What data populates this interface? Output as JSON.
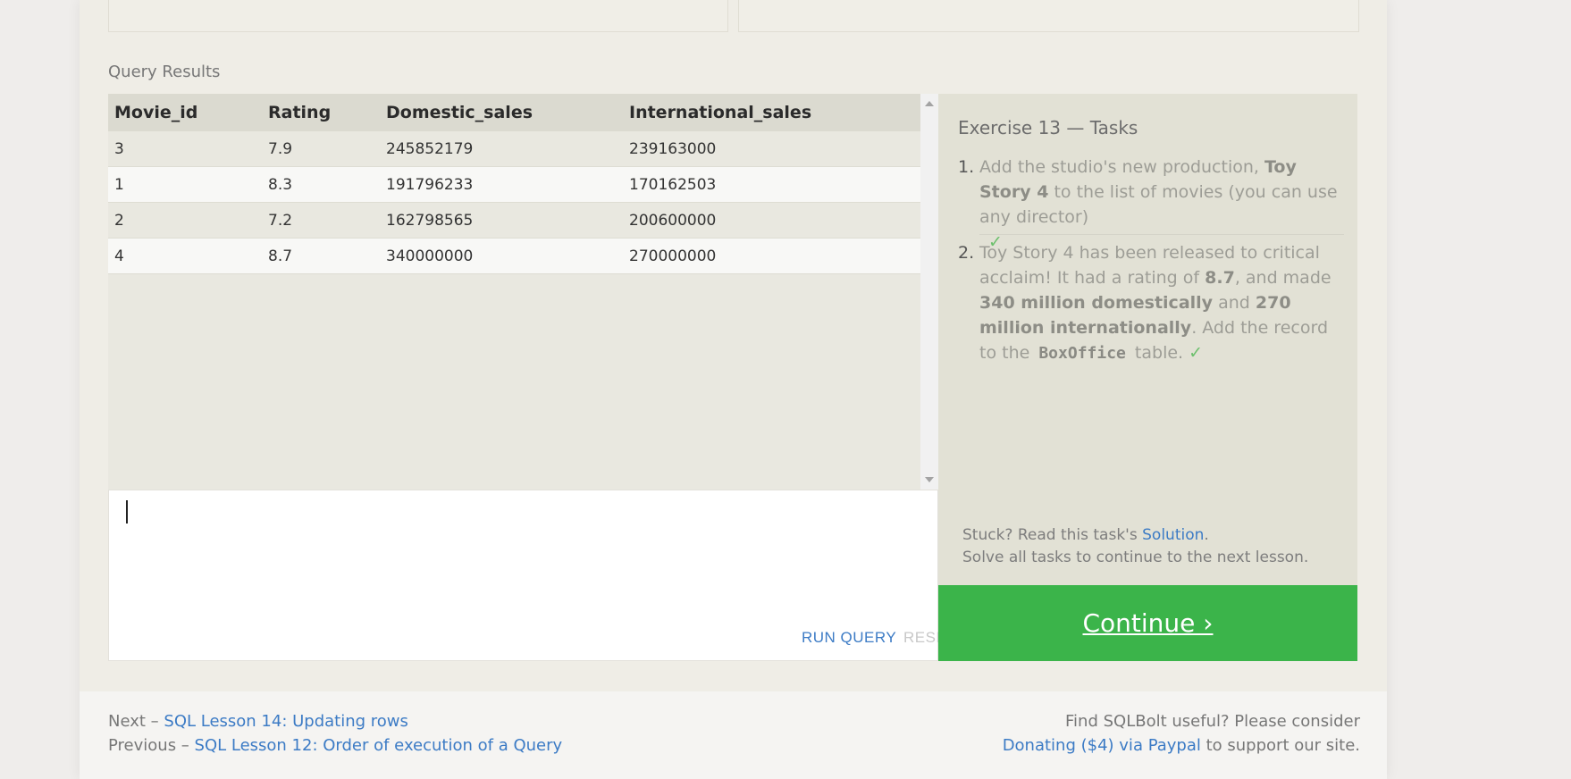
{
  "query_results": {
    "heading": "Query Results",
    "columns": [
      "Movie_id",
      "Rating",
      "Domestic_sales",
      "International_sales"
    ],
    "rows": [
      [
        "3",
        "7.9",
        "245852179",
        "239163000"
      ],
      [
        "1",
        "8.3",
        "191796233",
        "170162503"
      ],
      [
        "2",
        "7.2",
        "162798565",
        "200600000"
      ],
      [
        "4",
        "8.7",
        "340000000",
        "270000000"
      ]
    ]
  },
  "editor": {
    "run_label": "RUN QUERY",
    "reset_label": "RESET"
  },
  "tasks": {
    "title": "Exercise 13 — Tasks",
    "task1": {
      "num": "1.",
      "text_a": "Add the studio's new production, ",
      "bold_a": "Toy Story 4",
      "text_b": " to the list of movies (you can use any director)",
      "check": "✓"
    },
    "task2": {
      "num": "2.",
      "text_a": "Toy Story 4 has been released to critical acclaim! It had a rating of ",
      "bold_a": "8.7",
      "text_b": ", and made ",
      "bold_b": "340 million domestically",
      "text_c": " and ",
      "bold_c": "270 million internationally",
      "text_d": ". Add the record to the ",
      "code": "BoxOffice",
      "text_e": " table.",
      "check": "✓"
    },
    "stuck_text": "Stuck? Read this task's ",
    "solution_link": "Solution",
    "stuck_end": ".",
    "solve_all": "Solve all tasks to continue to the next lesson.",
    "continue_label": "Continue ›"
  },
  "footer": {
    "next_prefix": "Next – ",
    "next_link": "SQL Lesson 14: Updating rows",
    "prev_prefix": "Previous – ",
    "prev_link": "SQL Lesson 12: Order of execution of a Query",
    "useful_text": "Find SQLBolt useful? Please consider",
    "donate_link": "Donating ($4) via Paypal",
    "donate_suffix": " to support our site."
  },
  "colors": {
    "accent_link": "#3c7bc5",
    "continue_bg": "#3bb44a",
    "check": "#6cc06c"
  }
}
